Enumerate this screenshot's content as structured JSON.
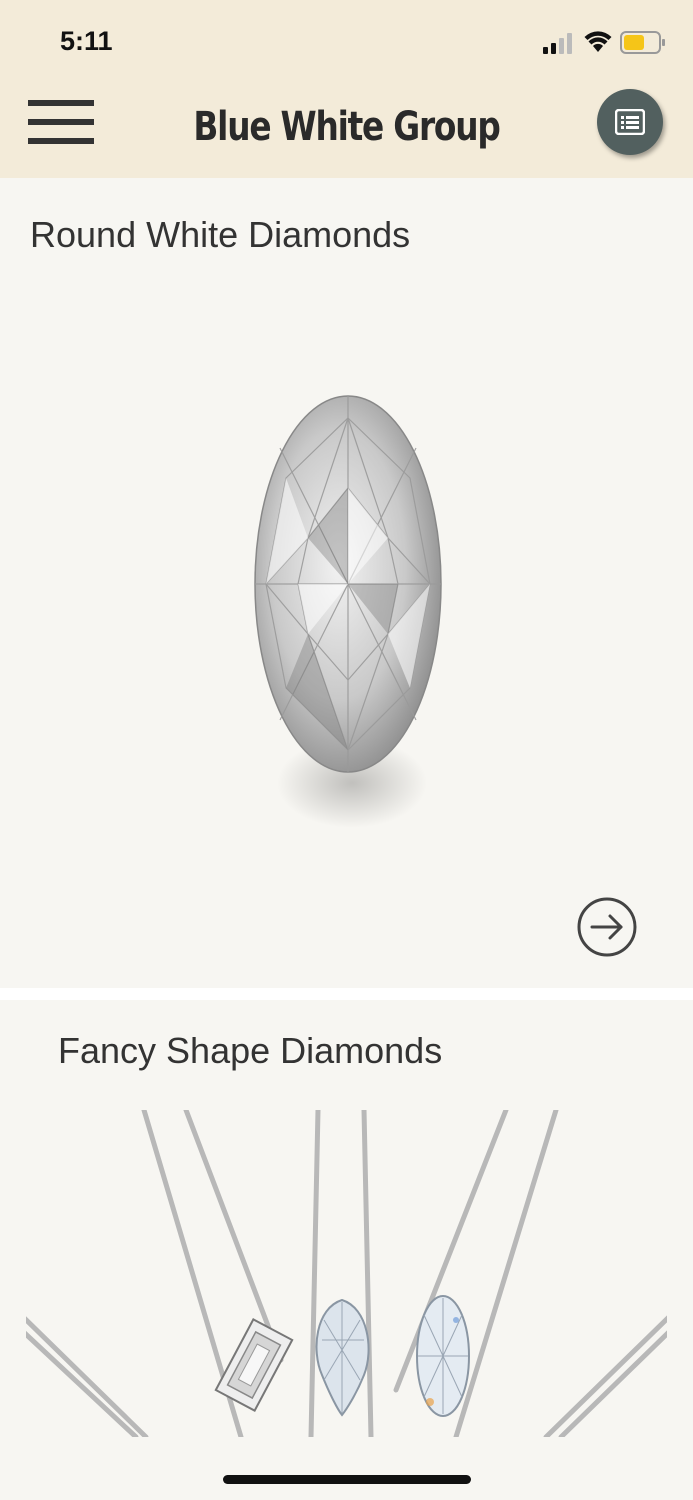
{
  "status_bar": {
    "time": "5:11",
    "battery_color": "#f5c518"
  },
  "header": {
    "title": "Blue White Group",
    "menu_icon": "hamburger-menu-icon",
    "list_icon": "list-icon",
    "background": "#f3ebd9"
  },
  "cards": [
    {
      "title": "Round White Diamonds",
      "image": "round-diamond",
      "action_icon": "arrow-right-circle-icon"
    },
    {
      "title": "Fancy Shape Diamonds",
      "image": "tweezers-holding-diamonds"
    }
  ],
  "colors": {
    "page_background": "#f7f6f2",
    "list_button": "#52605f"
  }
}
